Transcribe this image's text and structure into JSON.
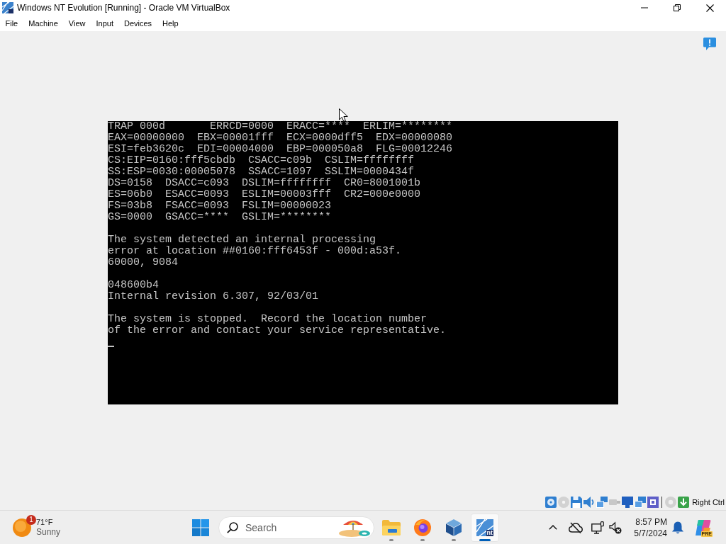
{
  "window": {
    "title": "Windows NT Evolution [Running] - Oracle VM VirtualBox"
  },
  "menu": [
    "File",
    "Machine",
    "View",
    "Input",
    "Devices",
    "Help"
  ],
  "console": {
    "blocks": [
      {
        "lines": [
          "TRAP 000d       ERRCD=0000  ERACC=****  ERLIM=********",
          "EAX=00000000  EBX=00001fff  ECX=0000dff5  EDX=00000080",
          "ESI=feb3620c  EDI=00004000  EBP=000050a8  FLG=00012246",
          "CS:EIP=0160:fff5cbdb  CSACC=c09b  CSLIM=ffffffff",
          "SS:ESP=0030:00005078  SSACC=1097  SSLIM=0000434f",
          "DS=0158  DSACC=c093  DSLIM=ffffffff  CR0=8001001b",
          "ES=06b0  ESACC=0093  ESLIM=00003fff  CR2=000e0000",
          "FS=03b8  FSACC=0093  FSLIM=00000023",
          "GS=0000  GSACC=****  GSLIM=********"
        ]
      },
      {
        "lines": [
          "The system detected an internal processing\nerror at location ##0160:fff6453f - 000d:a53f.",
          "60000, 9084"
        ]
      },
      {
        "lines": [
          "048600b4",
          "Internal revision 6.307, 92/03/01"
        ]
      },
      {
        "lines": [
          "The system is stopped.  Record the location number\nof the error and contact your service representative."
        ]
      }
    ]
  },
  "status_bar": {
    "indicators": [
      {
        "kind": "hard-disk",
        "disabled": false
      },
      {
        "kind": "optical",
        "disabled": true
      },
      {
        "kind": "floppy",
        "disabled": false
      },
      {
        "kind": "audio",
        "disabled": false
      },
      {
        "kind": "network",
        "disabled": false
      },
      {
        "kind": "usb",
        "disabled": true
      },
      {
        "kind": "shared-folders",
        "disabled": false
      },
      {
        "kind": "display",
        "disabled": false
      },
      {
        "kind": "cpu",
        "disabled": false
      },
      {
        "kind": "mouse",
        "disabled": true
      },
      {
        "kind": "keyboard",
        "disabled": false
      }
    ],
    "host_key": "Right Ctrl"
  },
  "taskbar": {
    "weather": {
      "badge": "1",
      "temperature": "71°F",
      "condition": "Sunny"
    },
    "search": {
      "placeholder": "Search"
    },
    "apps": [
      {
        "kind": "folder",
        "selected": false
      },
      {
        "kind": "browser",
        "selected": false
      },
      {
        "kind": "cube",
        "selected": false
      },
      {
        "kind": "vm",
        "selected": true,
        "logo_text": "nt"
      }
    ],
    "clock": {
      "time": "8:57 PM",
      "date": "5/7/2024"
    },
    "logo_badge": "PRE"
  }
}
